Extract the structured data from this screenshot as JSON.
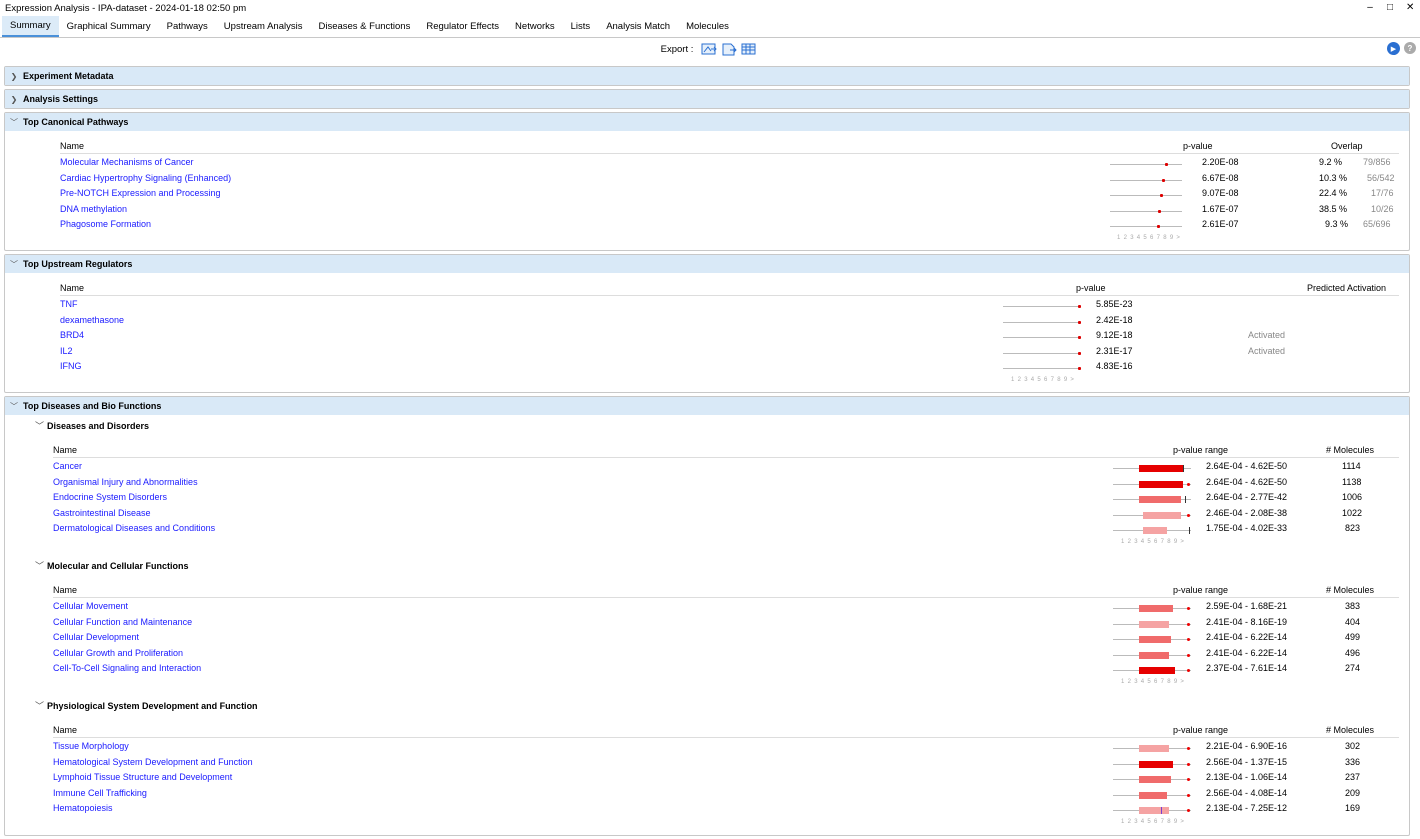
{
  "window": {
    "title": "Expression Analysis - IPA-dataset - 2024-01-18 02:50 pm"
  },
  "tabs": [
    "Summary",
    "Graphical Summary",
    "Pathways",
    "Upstream Analysis",
    "Diseases & Functions",
    "Regulator Effects",
    "Networks",
    "Lists",
    "Analysis Match",
    "Molecules"
  ],
  "export": {
    "label": "Export :"
  },
  "scale_text": "1 2 3 4 5 6 7 8 9 >",
  "sections": {
    "experiment_metadata": "Experiment Metadata",
    "analysis_settings": "Analysis Settings",
    "canonical_pathways": {
      "title": "Top Canonical Pathways",
      "col_name": "Name",
      "col_pvalue": "p-value",
      "col_overlap": "Overlap",
      "rows": [
        {
          "name": "Molecular Mechanisms of Cancer",
          "pvalue": "2.20E-08",
          "pct": "9.2 %",
          "ratio": "79/856"
        },
        {
          "name": "Cardiac Hypertrophy Signaling (Enhanced)",
          "pvalue": "6.67E-08",
          "pct": "10.3 %",
          "ratio": "56/542"
        },
        {
          "name": "Pre-NOTCH Expression and Processing",
          "pvalue": "9.07E-08",
          "pct": "22.4 %",
          "ratio": "17/76"
        },
        {
          "name": "DNA methylation",
          "pvalue": "1.67E-07",
          "pct": "38.5 %",
          "ratio": "10/26"
        },
        {
          "name": "Phagosome Formation",
          "pvalue": "2.61E-07",
          "pct": "9.3 %",
          "ratio": "65/696"
        }
      ]
    },
    "upstream_regulators": {
      "title": "Top Upstream Regulators",
      "col_name": "Name",
      "col_pvalue": "p-value",
      "col_activation": "Predicted Activation",
      "rows": [
        {
          "name": "TNF",
          "pvalue": "5.85E-23",
          "activation": ""
        },
        {
          "name": "dexamethasone",
          "pvalue": "2.42E-18",
          "activation": ""
        },
        {
          "name": "BRD4",
          "pvalue": "9.12E-18",
          "activation": "Activated"
        },
        {
          "name": "IL2",
          "pvalue": "2.31E-17",
          "activation": "Activated"
        },
        {
          "name": "IFNG",
          "pvalue": "4.83E-16",
          "activation": ""
        }
      ]
    },
    "diseases_bio_functions": {
      "title": "Top Diseases and Bio Functions",
      "col_name": "Name",
      "col_range": "p-value range",
      "col_molecules": "# Molecules",
      "groups": [
        {
          "title": "Diseases and Disorders",
          "rows": [
            {
              "name": "Cancer",
              "range": "2.64E-04 - 4.62E-50",
              "molecules": "1114"
            },
            {
              "name": "Organismal Injury and Abnormalities",
              "range": "2.64E-04 - 4.62E-50",
              "molecules": "1138"
            },
            {
              "name": "Endocrine System Disorders",
              "range": "2.64E-04 - 2.77E-42",
              "molecules": "1006"
            },
            {
              "name": "Gastrointestinal Disease",
              "range": "2.46E-04 - 2.08E-38",
              "molecules": "1022"
            },
            {
              "name": "Dermatological Diseases and Conditions",
              "range": "1.75E-04 - 4.02E-33",
              "molecules": "823"
            }
          ]
        },
        {
          "title": "Molecular and Cellular Functions",
          "rows": [
            {
              "name": "Cellular Movement",
              "range": "2.59E-04 - 1.68E-21",
              "molecules": "383"
            },
            {
              "name": "Cellular Function and Maintenance",
              "range": "2.41E-04 - 8.16E-19",
              "molecules": "404"
            },
            {
              "name": "Cellular Development",
              "range": "2.41E-04 - 6.22E-14",
              "molecules": "499"
            },
            {
              "name": "Cellular Growth and Proliferation",
              "range": "2.41E-04 - 6.22E-14",
              "molecules": "496"
            },
            {
              "name": "Cell-To-Cell Signaling and Interaction",
              "range": "2.37E-04 - 7.61E-14",
              "molecules": "274"
            }
          ]
        },
        {
          "title": "Physiological System Development and Function",
          "rows": [
            {
              "name": "Tissue Morphology",
              "range": "2.21E-04 - 6.90E-16",
              "molecules": "302"
            },
            {
              "name": "Hematological System Development and Function",
              "range": "2.56E-04 - 1.37E-15",
              "molecules": "336"
            },
            {
              "name": "Lymphoid Tissue Structure and Development",
              "range": "2.13E-04 - 1.06E-14",
              "molecules": "237"
            },
            {
              "name": "Immune Cell Trafficking",
              "range": "2.56E-04 - 4.08E-14",
              "molecules": "209"
            },
            {
              "name": "Hematopoiesis",
              "range": "2.13E-04 - 7.25E-12",
              "molecules": "169"
            }
          ]
        }
      ]
    }
  }
}
